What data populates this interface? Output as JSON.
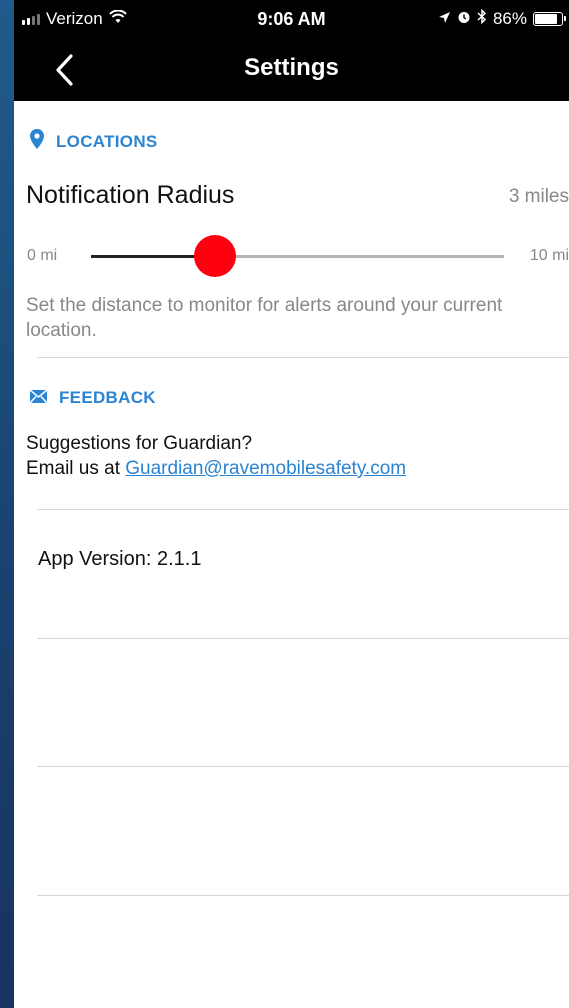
{
  "status_bar": {
    "carrier": "Verizon",
    "time": "9:06 AM",
    "battery": "86%",
    "battery_level": 0.86
  },
  "nav": {
    "title": "Settings"
  },
  "locations": {
    "header": "LOCATIONS",
    "title": "Notification Radius",
    "value": "3 miles",
    "slider_min": "0 mi",
    "slider_max": "10 mi",
    "slider_value": 3,
    "slider_range": [
      0,
      10
    ],
    "description": "Set the distance to monitor for alerts around your current location."
  },
  "feedback": {
    "header": "FEEDBACK",
    "line1": "Suggestions for Guardian?",
    "line2_prefix": "Email us at ",
    "email": "Guardian@ravemobilesafety.com"
  },
  "app_version": "App Version: 2.1.1",
  "colors": {
    "accent": "#2a84d2",
    "slider_thumb": "#ff0011",
    "header_bg": "#000000"
  }
}
